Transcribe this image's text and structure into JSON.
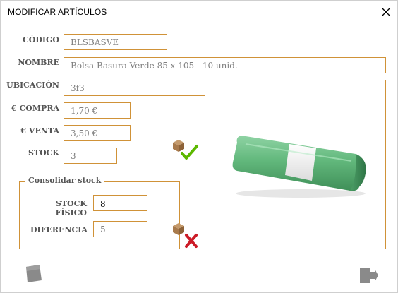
{
  "window": {
    "title": "MODIFICAR ARTÍCULOS"
  },
  "form": {
    "codigo": {
      "label": "CÓDIGO",
      "value": "BLSBASVE"
    },
    "nombre": {
      "label": "NOMBRE",
      "value": "Bolsa Basura Verde 85 x 105 - 10 unid."
    },
    "ubicacion": {
      "label": "UBICACIÓN",
      "value": "3f3"
    },
    "compra": {
      "label": "€ COMPRA",
      "value": "1,70 €"
    },
    "venta": {
      "label": "€ VENTA",
      "value": "3,50 €"
    },
    "stock": {
      "label": "STOCK",
      "value": "3"
    }
  },
  "consolidar": {
    "legend": "Consolidar stock",
    "stock_fisico": {
      "label": "STOCK FÍSICO",
      "value": "8"
    },
    "diferencia": {
      "label": "DIFERENCIA",
      "value": "5"
    }
  },
  "icons": {
    "accept": "box-check-icon",
    "reject": "box-cross-icon",
    "bottom_left": "gray-square-icon",
    "bottom_right": "exit-door-icon"
  },
  "colors": {
    "accent_border": "#d09238",
    "check": "#5cb800",
    "cross": "#cc1b27",
    "icon_gray": "#8a8a8a"
  }
}
